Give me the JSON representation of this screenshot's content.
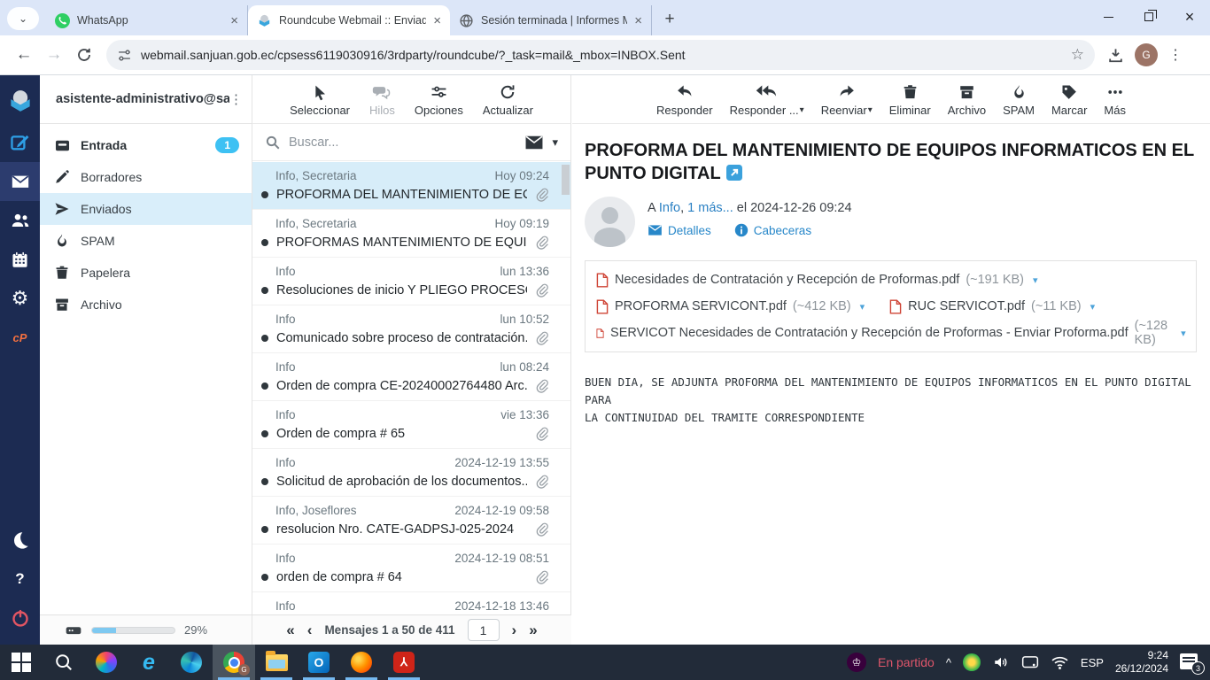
{
  "browser": {
    "tabs": [
      {
        "title": "WhatsApp",
        "icon": "whatsapp"
      },
      {
        "title": "Roundcube Webmail :: Enviados",
        "icon": "roundcube",
        "active": true
      },
      {
        "title": "Sesión terminada | Informes Me",
        "icon": "globe"
      }
    ],
    "url": "webmail.sanjuan.gob.ec/cpsess6119030916/3rdparty/roundcube/?_task=mail&_mbox=INBOX.Sent",
    "profile_initial": "G"
  },
  "sidebar": {
    "account": "asistente-administrativo@sa...",
    "folders": [
      {
        "label": "Entrada",
        "badge": "1",
        "bold": true
      },
      {
        "label": "Borradores"
      },
      {
        "label": "Enviados",
        "selected": true
      },
      {
        "label": "SPAM"
      },
      {
        "label": "Papelera"
      },
      {
        "label": "Archivo"
      }
    ]
  },
  "list": {
    "toolbar": {
      "select": "Seleccionar",
      "threads": "Hilos",
      "options": "Opciones",
      "refresh": "Actualizar"
    },
    "search_placeholder": "Buscar...",
    "messages": [
      {
        "sender": "Info, Secretaria",
        "date": "Hoy 09:24",
        "subject": "PROFORMA DEL MANTENIMIENTO DE EQU...",
        "selected": true
      },
      {
        "sender": "Info, Secretaria",
        "date": "Hoy 09:19",
        "subject": "PROFORMAS MANTENIMIENTO DE EQUIP..."
      },
      {
        "sender": "Info",
        "date": "lun 13:36",
        "subject": "Resoluciones de inicio Y PLIEGO PROCESO ..."
      },
      {
        "sender": "Info",
        "date": "lun 10:52",
        "subject": "Comunicado sobre proceso de contratación."
      },
      {
        "sender": "Info",
        "date": "lun 08:24",
        "subject": "Orden de compra CE-20240002764480 Arc..."
      },
      {
        "sender": "Info",
        "date": "vie 13:36",
        "subject": "Orden de compra # 65"
      },
      {
        "sender": "Info",
        "date": "2024-12-19 13:55",
        "subject": "Solicitud de aprobación de los documentos..."
      },
      {
        "sender": "Info, Joseflores",
        "date": "2024-12-19 09:58",
        "subject": "resolucion Nro. CATE-GADPSJ-025-2024"
      },
      {
        "sender": "Info",
        "date": "2024-12-19 08:51",
        "subject": "orden de compra # 64"
      },
      {
        "sender": "Info",
        "date": "2024-12-18 13:46",
        "subject": ""
      }
    ],
    "quota_percent": "29%",
    "pagination": {
      "label": "Mensajes 1 a 50 de 411",
      "page": "1"
    }
  },
  "viewer": {
    "toolbar": {
      "reply": "Responder",
      "reply_all": "Responder ...",
      "forward": "Reenviar",
      "delete": "Eliminar",
      "archive": "Archivo",
      "spam": "SPAM",
      "mark": "Marcar",
      "more": "Más"
    },
    "title": "PROFORMA DEL MANTENIMIENTO DE EQUIPOS INFORMATICOS EN EL PUNTO DIGITAL",
    "to_prefix": "A",
    "to_link": "Info",
    "to_separator": ", ",
    "to_more": "1 más...",
    "sent_date": " el 2024-12-26 09:24",
    "details_label": "Detalles",
    "headers_label": "Cabeceras",
    "attachments": [
      {
        "name": "Necesidades de Contratación y Recepción de Proformas.pdf",
        "size": "(~191 KB)"
      },
      {
        "name": "PROFORMA SERVICONT.pdf",
        "size": "(~412 KB)"
      },
      {
        "name": "RUC SERVICOT.pdf",
        "size": "(~11 KB)"
      },
      {
        "name": "SERVICOT Necesidades de Contratación y Recepción de Proformas - Enviar Proforma.pdf",
        "size": "(~128 KB)"
      }
    ],
    "body_line1": "BUEN DIA, SE ADJUNTA PROFORMA DEL MANTENIMIENTO DE EQUIPOS INFORMATICOS EN EL PUNTO DIGITAL PARA",
    "body_line2": "LA CONTINUIDAD DEL TRAMITE CORRESPONDIENTE"
  },
  "taskbar": {
    "tray_status": "En partido",
    "language": "ESP",
    "time": "9:24",
    "date": "26/12/2024",
    "notification_count": "3"
  },
  "colors": {
    "navy_rail": "#1c2b52",
    "selection_blue": "#d7edf9",
    "badge_blue": "#3ec1f3",
    "link_blue": "#2a80c3",
    "pdf_red": "#cf4436",
    "tray_status_red": "#e0566b"
  }
}
